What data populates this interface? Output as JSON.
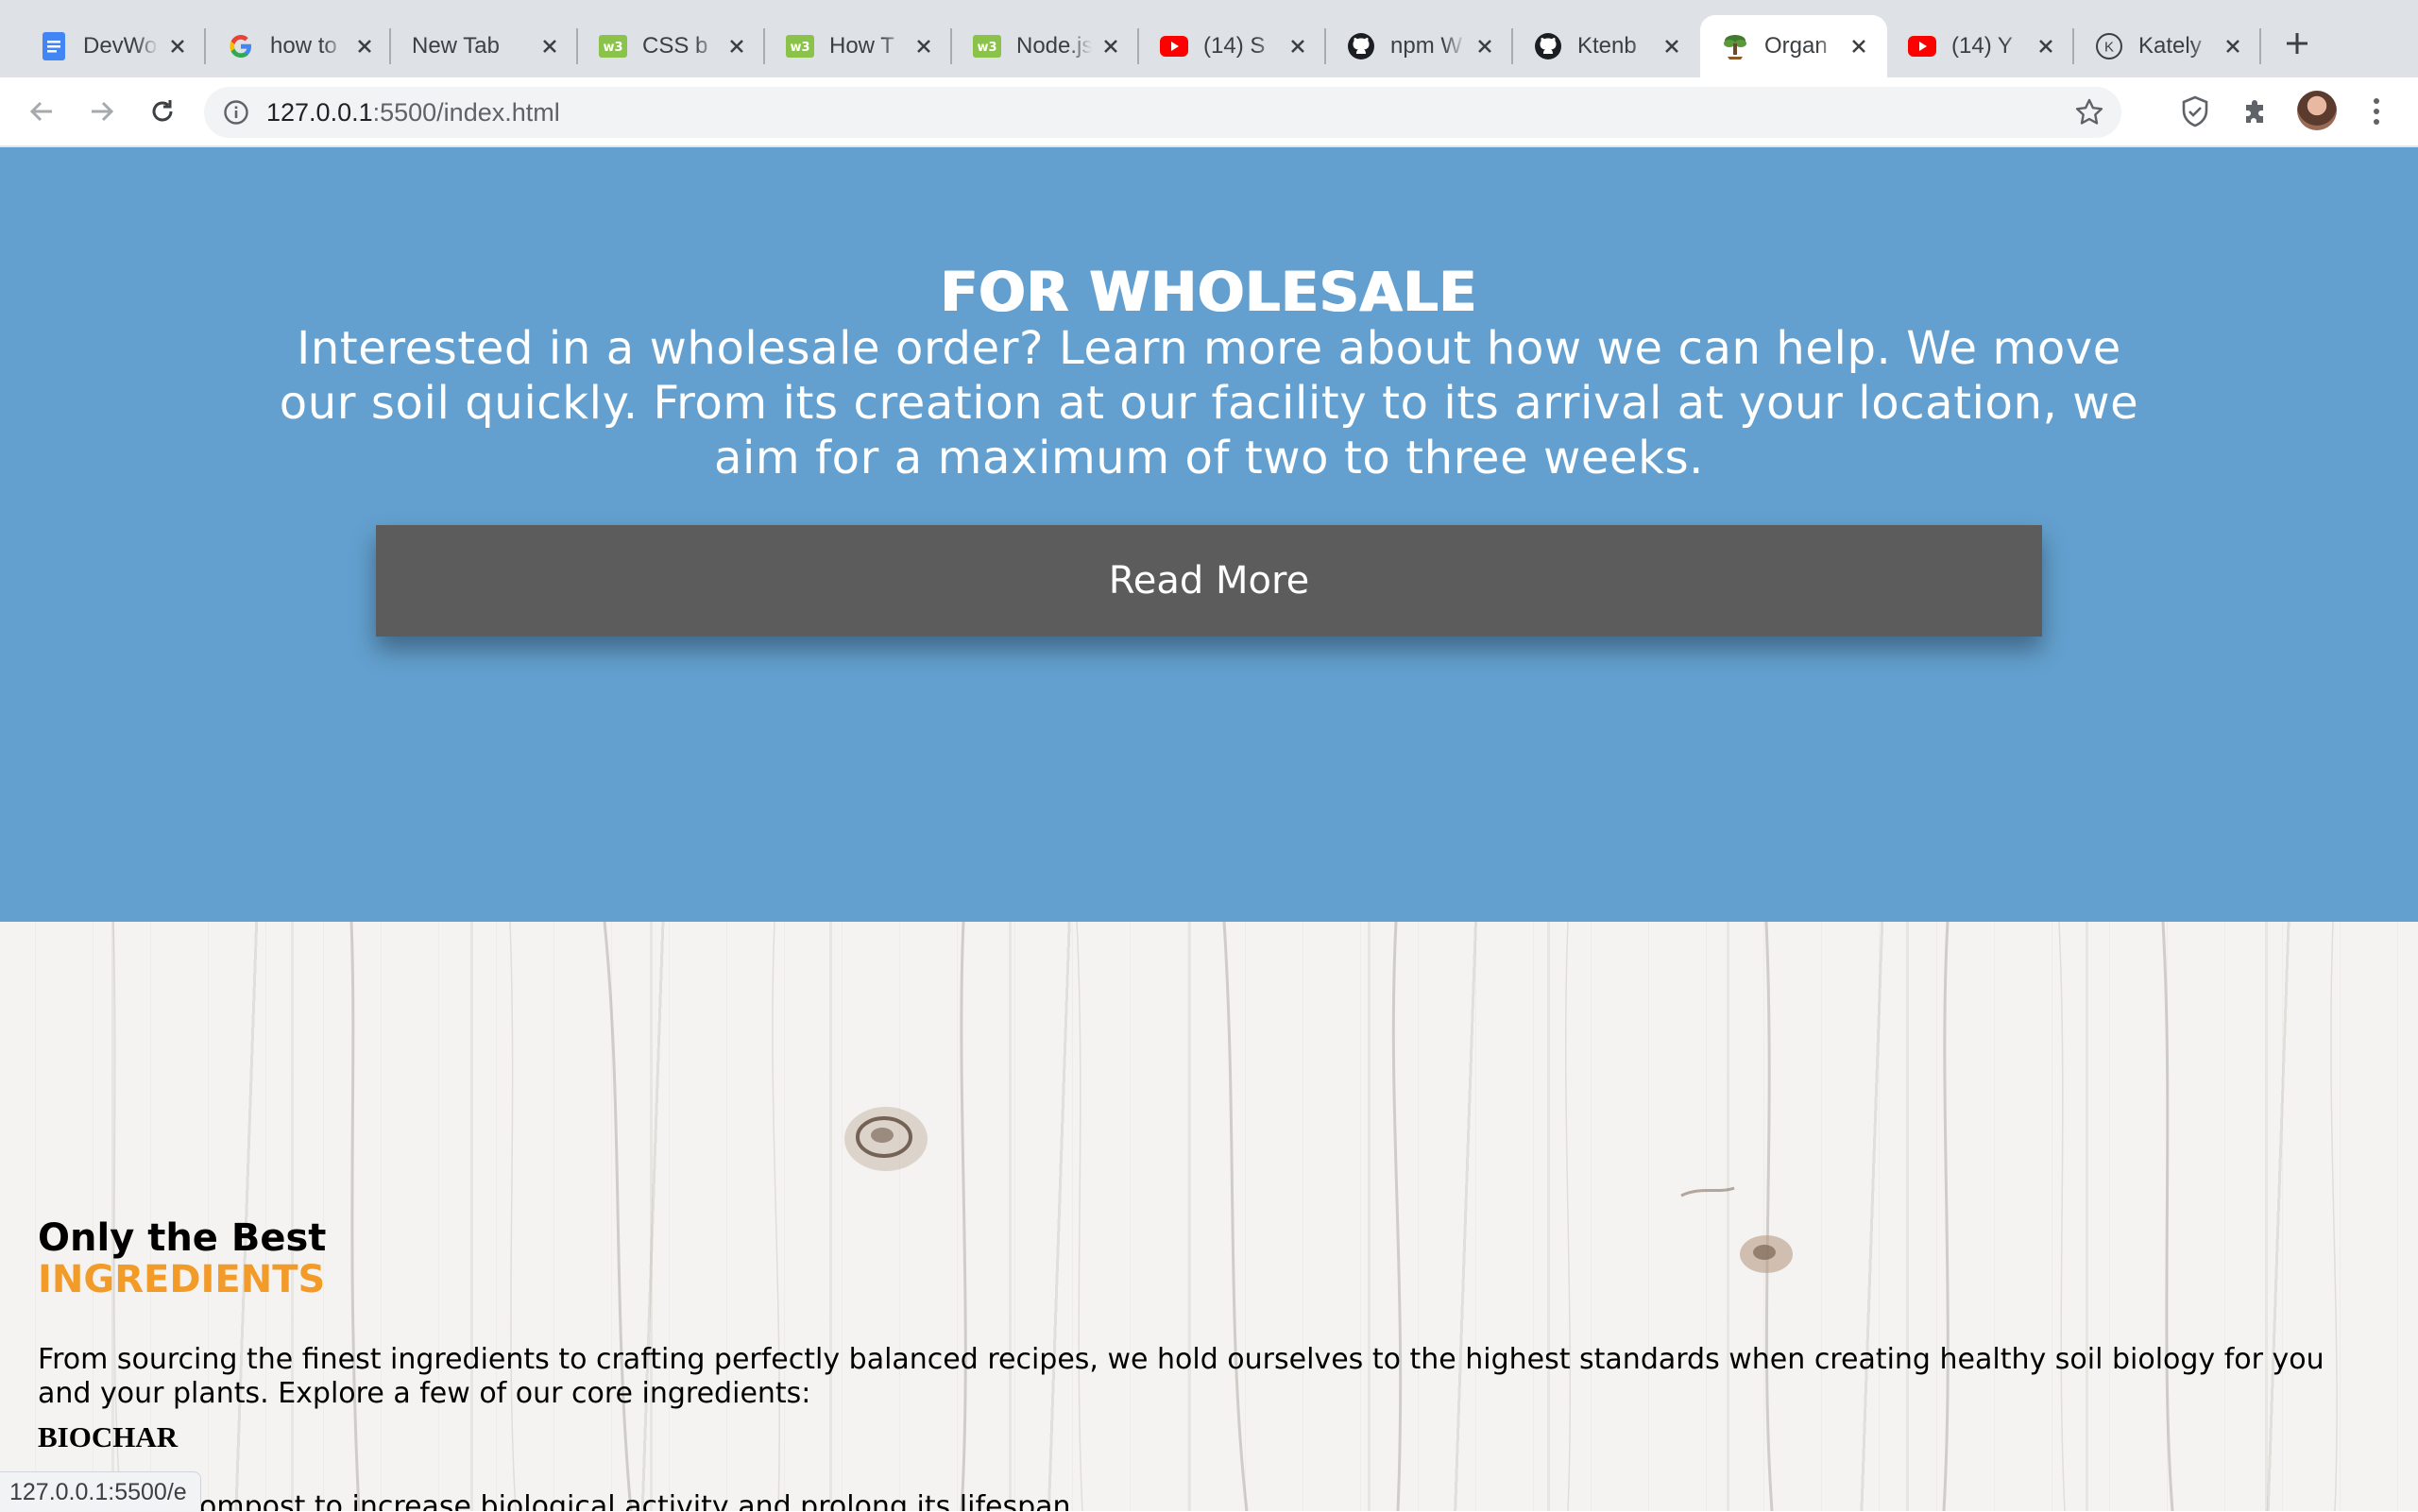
{
  "browser": {
    "tabs": [
      {
        "title": "DevWorld",
        "icon": "docs-icon",
        "active": false
      },
      {
        "title": "how to",
        "icon": "google-icon",
        "active": false
      },
      {
        "title": "New Tab",
        "icon": "",
        "active": false
      },
      {
        "title": "CSS b",
        "icon": "w3schools-icon",
        "active": false
      },
      {
        "title": "How T",
        "icon": "w3schools-icon",
        "active": false
      },
      {
        "title": "Node.js",
        "icon": "w3schools-icon",
        "active": false
      },
      {
        "title": "(14) S",
        "icon": "youtube-icon",
        "active": false
      },
      {
        "title": "npm W",
        "icon": "github-icon",
        "active": false
      },
      {
        "title": "Ktenb",
        "icon": "github-icon",
        "active": false
      },
      {
        "title": "Organ",
        "icon": "tree-icon",
        "active": true
      },
      {
        "title": "(14) Y",
        "icon": "youtube-icon",
        "active": false
      },
      {
        "title": "Kately",
        "icon": "k-circle-icon",
        "active": false
      }
    ],
    "url_host": "127.0.0.1",
    "url_rest": ":5500/index.html",
    "status_url": "127.0.0.1:5500/e"
  },
  "wholesale": {
    "heading": "FOR WHOLESALE",
    "body": "Interested in a wholesale order? Learn more about how we can help. We move our soil quickly. From its creation at our facility to its arrival at your location, we aim for a maximum of two to three weeks.",
    "button_label": "Read More"
  },
  "ingredients": {
    "title": "Only the Best",
    "subtitle": "INGREDIENTS",
    "body": "From sourcing the finest ingredients to crafting perfectly balanced recipes, we hold ourselves to the highest standards when creating healthy soil biology for you and your plants. Explore a few of our core ingredients:",
    "item_name": "BIOCHAR",
    "item_description": "Enhances compost to increase biological activity and prolong its lifespan"
  },
  "colors": {
    "wholesale_bg": "#63a0cf",
    "button_bg": "#5c5c5c",
    "accent_orange": "#f29b28"
  }
}
